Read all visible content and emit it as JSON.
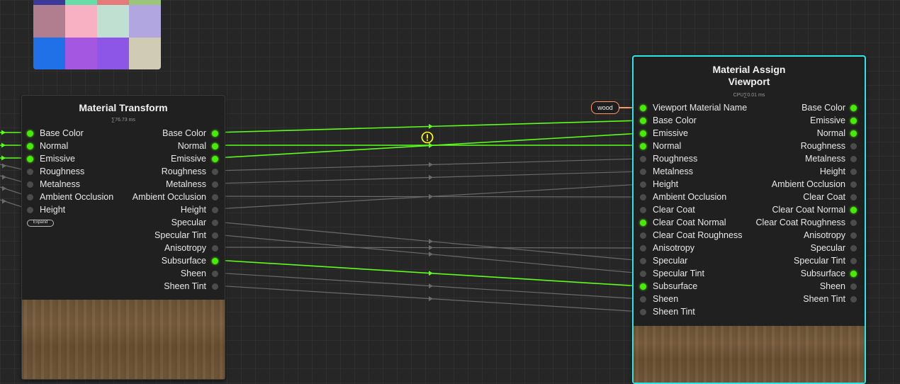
{
  "colors": {
    "active_wire": "#5cff1a",
    "inactive_wire": "#6a6a6a",
    "viewport_border": "#2ee6e6",
    "output_wire": "#ff9966",
    "warning": "#ffff00"
  },
  "palette": {
    "swatches": [
      "#3b3a9a",
      "#66dca8",
      "#e67a7a",
      "#9cc47a",
      "#b07e8e",
      "#f7b1c2",
      "#c0e0d2",
      "#b2a6e0",
      "#2070e8",
      "#a458e2",
      "#8d56e6",
      "#cfcbb5"
    ]
  },
  "material_transform": {
    "title": "Material Transform",
    "timing": "∑76.73 ms",
    "expand_label": "Expand",
    "inputs": [
      {
        "label": "Base Color",
        "connected": true
      },
      {
        "label": "Normal",
        "connected": true
      },
      {
        "label": "Emissive",
        "connected": true
      },
      {
        "label": "Roughness",
        "connected": false
      },
      {
        "label": "Metalness",
        "connected": false
      },
      {
        "label": "Ambient Occlusion",
        "connected": false
      },
      {
        "label": "Height",
        "connected": false
      }
    ],
    "outputs": [
      {
        "label": "Base Color",
        "connected": true
      },
      {
        "label": "Normal",
        "connected": true
      },
      {
        "label": "Emissive",
        "connected": true
      },
      {
        "label": "Roughness",
        "connected": false
      },
      {
        "label": "Metalness",
        "connected": false
      },
      {
        "label": "Ambient Occlusion",
        "connected": false
      },
      {
        "label": "Height",
        "connected": false
      },
      {
        "label": "Specular",
        "connected": false
      },
      {
        "label": "Specular Tint",
        "connected": false
      },
      {
        "label": "Anisotropy",
        "connected": false
      },
      {
        "label": "Subsurface",
        "connected": true
      },
      {
        "label": "Sheen",
        "connected": false
      },
      {
        "label": "Sheen Tint",
        "connected": false
      }
    ]
  },
  "material_assign": {
    "title": "Material Assign",
    "title2": "Viewport",
    "timing": "CPU∑0.01 ms",
    "inputs": [
      {
        "label": "Viewport Material Name",
        "connected": true
      },
      {
        "label": "Base Color",
        "connected": true
      },
      {
        "label": "Emissive",
        "connected": true
      },
      {
        "label": "Normal",
        "connected": true
      },
      {
        "label": "Roughness",
        "connected": false
      },
      {
        "label": "Metalness",
        "connected": false
      },
      {
        "label": "Height",
        "connected": false
      },
      {
        "label": "Ambient Occlusion",
        "connected": false
      },
      {
        "label": "Clear Coat",
        "connected": false
      },
      {
        "label": "Clear Coat Normal",
        "connected": true
      },
      {
        "label": "Clear Coat Roughness",
        "connected": false
      },
      {
        "label": "Anisotropy",
        "connected": false
      },
      {
        "label": "Specular",
        "connected": false
      },
      {
        "label": "Specular Tint",
        "connected": false
      },
      {
        "label": "Subsurface",
        "connected": true
      },
      {
        "label": "Sheen",
        "connected": false
      },
      {
        "label": "Sheen Tint",
        "connected": false
      }
    ],
    "outputs": [
      {
        "label": "Base Color",
        "connected": true
      },
      {
        "label": "Emissive",
        "connected": true
      },
      {
        "label": "Normal",
        "connected": true
      },
      {
        "label": "Roughness",
        "connected": false
      },
      {
        "label": "Metalness",
        "connected": false
      },
      {
        "label": "Height",
        "connected": false
      },
      {
        "label": "Ambient Occlusion",
        "connected": false
      },
      {
        "label": "Clear Coat",
        "connected": false
      },
      {
        "label": "Clear Coat Normal",
        "connected": true
      },
      {
        "label": "Clear Coat Roughness",
        "connected": false
      },
      {
        "label": "Anisotropy",
        "connected": false
      },
      {
        "label": "Specular",
        "connected": false
      },
      {
        "label": "Specular Tint",
        "connected": false
      },
      {
        "label": "Subsurface",
        "connected": true
      },
      {
        "label": "Sheen",
        "connected": false
      },
      {
        "label": "Sheen Tint",
        "connected": false
      }
    ]
  },
  "wood_tag": {
    "label": "wood"
  }
}
